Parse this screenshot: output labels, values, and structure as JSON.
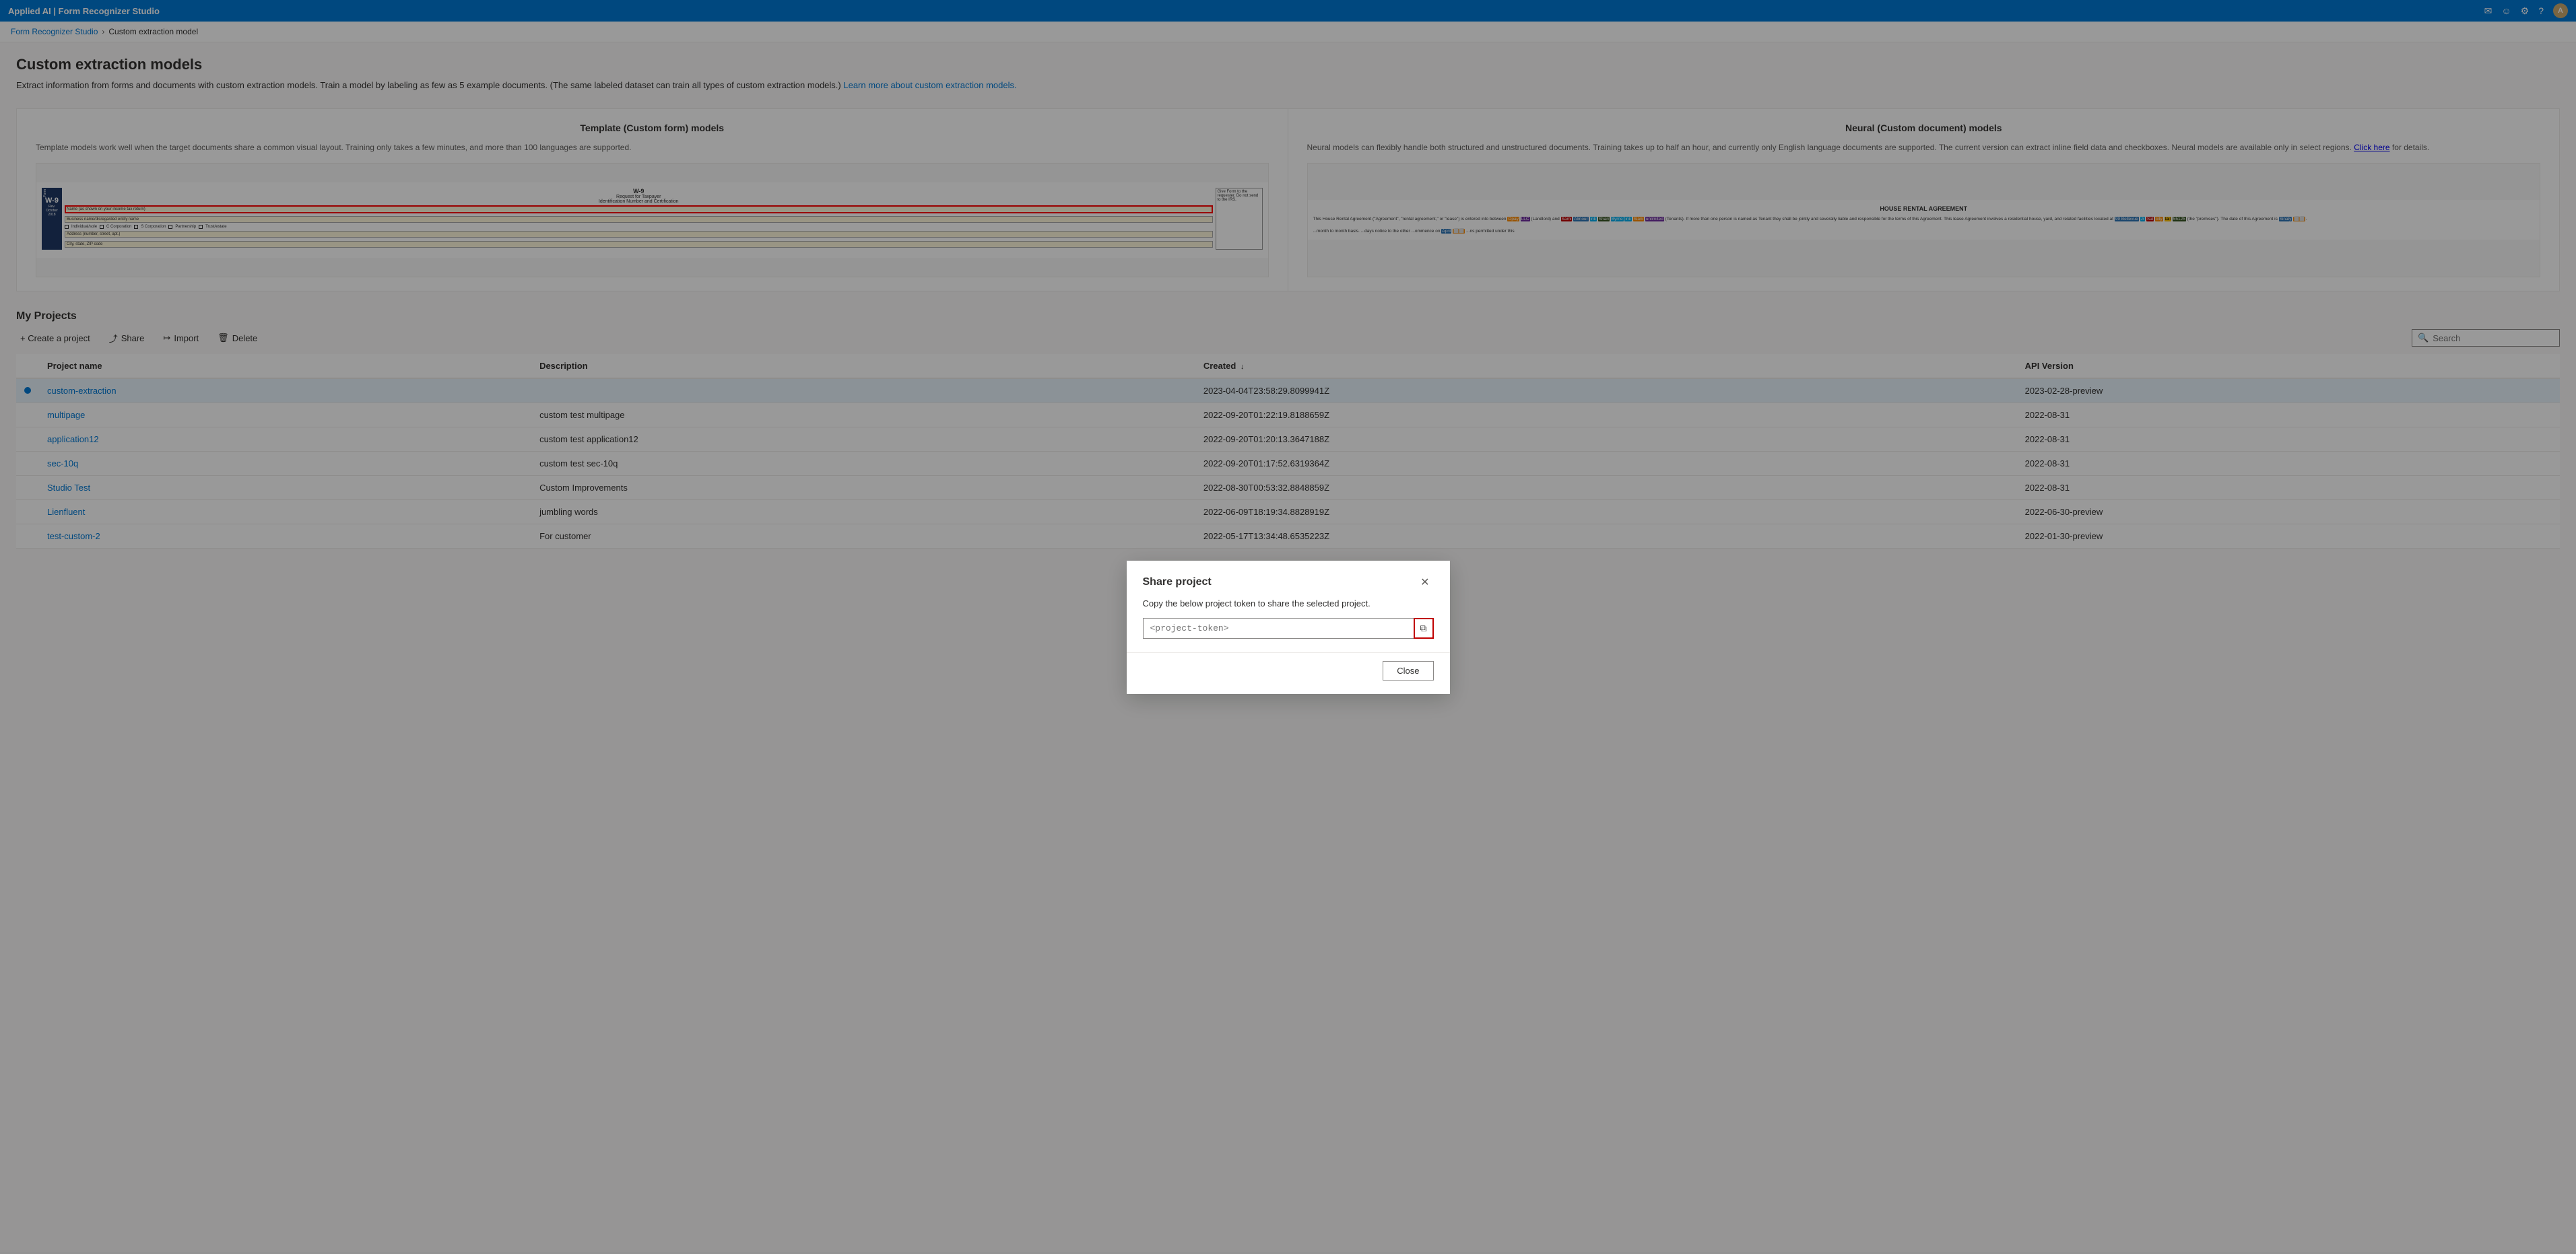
{
  "topbar": {
    "title": "Applied AI | Form Recognizer Studio",
    "icons": [
      "mail",
      "smiley",
      "settings",
      "help",
      "avatar"
    ]
  },
  "breadcrumb": {
    "home": "Form Recognizer Studio",
    "current": "Custom extraction model"
  },
  "page": {
    "title": "Custom extraction models",
    "description": "Extract information from forms and documents with custom extraction models. Train a model by labeling as few as 5 example documents. (The same labeled dataset can train all types of custom extraction models.)",
    "learn_more_text": "Learn more about custom extraction models."
  },
  "template_model": {
    "title": "Template (Custom form) models",
    "description": "Template models work well when the target documents share a common visual layout. Training only takes a few minutes, and more than 100 languages are supported."
  },
  "neural_model": {
    "title": "Neural (Custom document) models",
    "description": "Neural models can flexibly handle both structured and unstructured documents. Training takes up to half an hour, and currently only English language documents are supported. The current version can extract inline field data and checkboxes. Neural models are available only in select regions.",
    "click_here": "Click here",
    "for_details": " for details."
  },
  "projects_section": {
    "title": "My Projects"
  },
  "toolbar": {
    "create_label": "+ Create a project",
    "share_label": "Share",
    "import_label": "Import",
    "delete_label": "Delete",
    "search_placeholder": "Search"
  },
  "table": {
    "columns": [
      "",
      "Project name",
      "Description",
      "Created ↓",
      "API Version"
    ],
    "rows": [
      {
        "indicator": true,
        "name": "custom-extraction",
        "description": "",
        "created": "2023-04-04T23:58:29.8099941Z",
        "api_version": "2023-02-28-preview"
      },
      {
        "indicator": false,
        "name": "multipage",
        "description": "custom test multipage",
        "created": "2022-09-20T01:22:19.8188659Z",
        "api_version": "2022-08-31"
      },
      {
        "indicator": false,
        "name": "application12",
        "description": "custom test application12",
        "created": "2022-09-20T01:20:13.3647188Z",
        "api_version": "2022-08-31"
      },
      {
        "indicator": false,
        "name": "sec-10q",
        "description": "custom test sec-10q",
        "created": "2022-09-20T01:17:52.6319364Z",
        "api_version": "2022-08-31"
      },
      {
        "indicator": false,
        "name": "Studio Test",
        "description": "Custom Improvements",
        "created": "2022-08-30T00:53:32.8848859Z",
        "api_version": "2022-08-31"
      },
      {
        "indicator": false,
        "name": "Lienfluent",
        "description": "jumbling words",
        "created": "2022-06-09T18:19:34.8828919Z",
        "api_version": "2022-06-30-preview"
      },
      {
        "indicator": false,
        "name": "test-custom-2",
        "description": "For customer",
        "created": "2022-05-17T13:34:48.6535223Z",
        "api_version": "2022-01-30-preview"
      }
    ]
  },
  "modal": {
    "title": "Share project",
    "description": "Copy the below project token to share the selected project.",
    "token_placeholder": "<project-token>",
    "close_label": "Close"
  }
}
